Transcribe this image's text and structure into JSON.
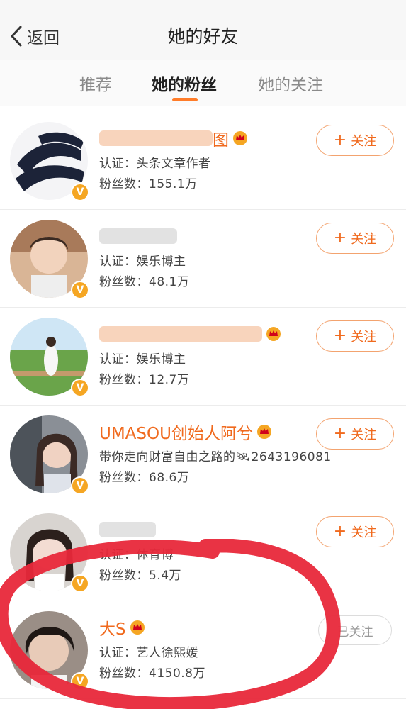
{
  "navbar": {
    "back_label": "返回",
    "title": "她的好友"
  },
  "tabs": [
    {
      "label": "推荐",
      "active": false
    },
    {
      "label": "她的粉丝",
      "active": true
    },
    {
      "label": "她的关注",
      "active": false
    }
  ],
  "follow_label": "关注",
  "followed_label": "已关注",
  "users": [
    {
      "name": "图",
      "line1": "认证：头条文章作者",
      "line2": "粉丝数：155.1万",
      "followed": false
    },
    {
      "name": "",
      "line1": "认证：娱乐博主",
      "line2": "粉丝数：48.1万",
      "followed": false
    },
    {
      "name": "",
      "line1": "认证：娱乐博主",
      "line2": "粉丝数：12.7万",
      "followed": false
    },
    {
      "name": "UMASOU创始人阿兮",
      "line1": "带你走向财富自由之路的🛰2643196081",
      "line2": "粉丝数：68.6万",
      "followed": false
    },
    {
      "name": "",
      "line1": "认证：体育博",
      "line2": "粉丝数：5.4万",
      "followed": false
    },
    {
      "name": "大S",
      "line1": "认证：艺人徐熙媛",
      "line2": "粉丝数：4150.8万",
      "followed": true
    }
  ],
  "colors": {
    "accent": "#f06a1e",
    "indicator": "#ff7c29",
    "badge": "#f5a623",
    "annotation": "#e8283a"
  },
  "icons": [
    "back-chevron-icon",
    "verified-badge-icon",
    "vip-crown-icon",
    "plus-icon"
  ]
}
